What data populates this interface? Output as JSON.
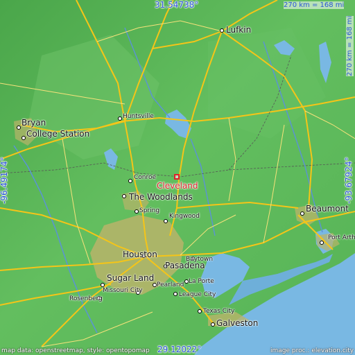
{
  "map": {
    "coordinates": {
      "north": "31.54738°",
      "south": "29.12022°",
      "west": "-96.49174°",
      "east": "-93.67924°"
    },
    "scale": {
      "horizontal": "270 km = 168 mi",
      "vertical": "270 km = 168 mi"
    },
    "attribution": {
      "left": "map data: openstreetmap, style: opentopomap",
      "right": "image proc.: elevation.city"
    },
    "highlighted_city": "Cleveland",
    "places": {
      "lufkin": "Lufkin",
      "bryan": "Bryan",
      "college_station": "College Station",
      "huntsville": "Huntsville",
      "conroe": "Conroe",
      "the_woodlands": "The Woodlands",
      "spring": "Spring",
      "kingwood": "Kingwood",
      "beaumont": "Beaumont",
      "port_arthur": "Port Arth",
      "houston": "Houston",
      "baytown": "Baytown",
      "pasadena": "Pasadena",
      "sugar_land": "Sugar Land",
      "pearland": "Pearland",
      "la_porte": "La Porte",
      "missouri_city": "Missouri City",
      "rosenberg": "Rosenberg",
      "league_city": "League City",
      "texas_city": "Texas City",
      "galveston": "Galveston"
    },
    "colors": {
      "land": "#5cb85c",
      "water": "#79b8e3",
      "highway": "#f5c518",
      "urban": "#b9b46a",
      "highlight": "#e0212b",
      "coordinate_text": "#2a55d6"
    }
  }
}
